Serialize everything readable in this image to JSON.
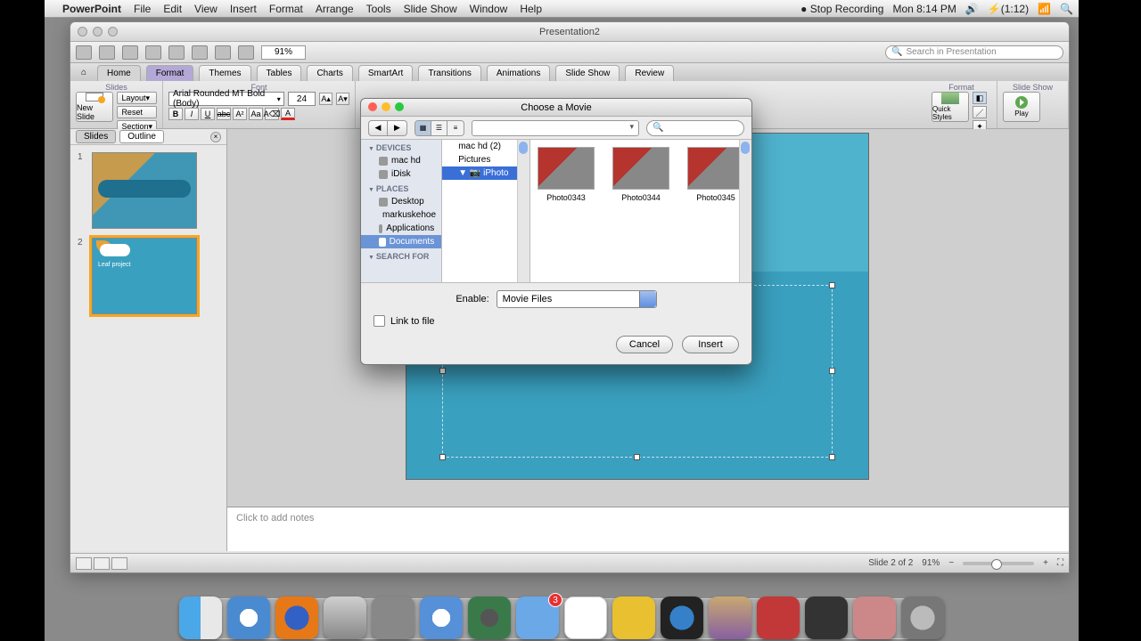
{
  "menubar": {
    "app": "PowerPoint",
    "items": [
      "File",
      "Edit",
      "View",
      "Insert",
      "Format",
      "Arrange",
      "Tools",
      "Slide Show",
      "Window",
      "Help"
    ],
    "stop_rec": "Stop Recording",
    "clock": "Mon 8:14 PM",
    "battery": "(1:12)"
  },
  "window": {
    "title": "Presentation2",
    "zoom": "91%",
    "search_placeholder": "Search in Presentation"
  },
  "ribbon": {
    "tabs": [
      "Home",
      "Format",
      "Themes",
      "Tables",
      "Charts",
      "SmartArt",
      "Transitions",
      "Animations",
      "Slide Show",
      "Review"
    ],
    "group_slides": "Slides",
    "group_font": "Font",
    "group_format": "Format",
    "group_show": "Slide Show",
    "new_slide": "New Slide",
    "layout": "Layout",
    "reset": "Reset",
    "section": "Section",
    "font_name": "Arial Rounded MT Bold (Body)",
    "font_size": "24",
    "quick_styles": "Quick Styles",
    "play": "Play"
  },
  "pane": {
    "tabs": [
      "Slides",
      "Outline"
    ],
    "slide2_title": "Leaf project"
  },
  "notes": {
    "placeholder": "Click to add notes"
  },
  "statusbar": {
    "slide": "Slide 2 of 2",
    "zoom": "91%"
  },
  "dialog": {
    "title": "Choose a Movie",
    "search_icon": "🔍",
    "sidebar": {
      "devices": "DEVICES",
      "devices_items": [
        "mac hd",
        "iDisk"
      ],
      "places": "PLACES",
      "places_items": [
        "Desktop",
        "markuskehoe",
        "Applications",
        "Documents"
      ],
      "search": "SEARCH FOR"
    },
    "column": [
      "mac hd (2)",
      "Pictures",
      "iPhoto"
    ],
    "grid": [
      "Photo0343",
      "Photo0344",
      "Photo0345"
    ],
    "enable_label": "Enable:",
    "enable_value": "Movie Files",
    "link_label": "Link to file",
    "cancel": "Cancel",
    "insert": "Insert"
  },
  "dock": {
    "badge": "3"
  }
}
